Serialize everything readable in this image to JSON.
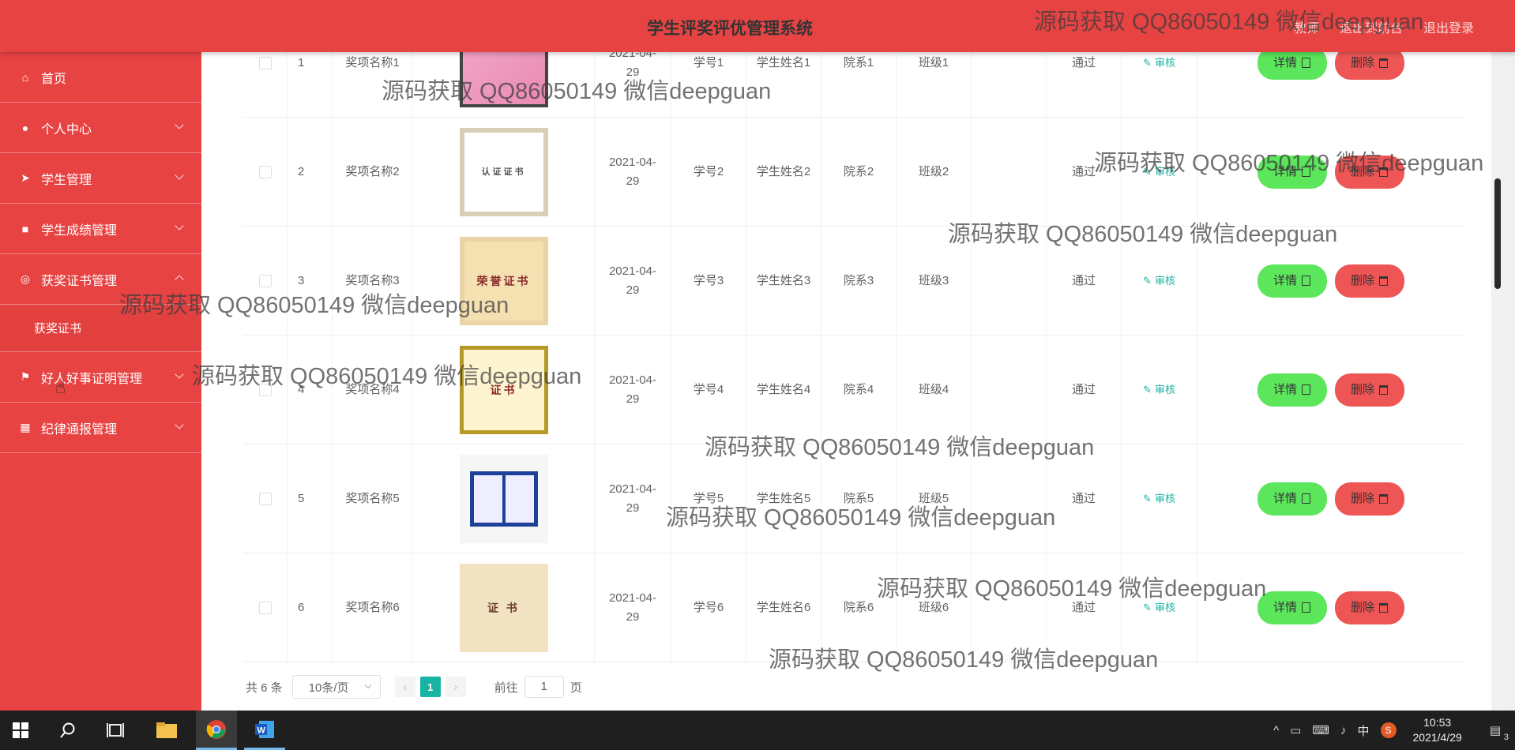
{
  "header": {
    "title": "学生评奖评优管理系统",
    "role_link": "教师",
    "front_link": "退出到前台",
    "logout_link": "退出登录"
  },
  "sidebar": {
    "items": [
      {
        "label": "首页",
        "icon": "home-icon",
        "has_arrow": false
      },
      {
        "label": "个人中心",
        "icon": "user-icon",
        "has_arrow": true
      },
      {
        "label": "学生管理",
        "icon": "send-icon",
        "has_arrow": true
      },
      {
        "label": "学生成绩管理",
        "icon": "video-camera-icon",
        "has_arrow": true
      },
      {
        "label": "获奖证书管理",
        "icon": "globe-icon",
        "has_arrow": true,
        "expanded": true
      },
      {
        "label": "好人好事证明管理",
        "icon": "flag-icon",
        "has_arrow": true
      },
      {
        "label": "纪律通报管理",
        "icon": "grid-icon",
        "has_arrow": true
      }
    ],
    "submenu": {
      "label": "获奖证书"
    }
  },
  "table": {
    "audit_label": "审核",
    "detail_label": "详情",
    "delete_label": "删除",
    "rows": [
      {
        "index": "1",
        "award": "奖项名称1",
        "date": "2021-04-29",
        "student_no": "学号1",
        "student_name": "学生姓名1",
        "faculty": "院系1",
        "class": "班级1",
        "status": "通过"
      },
      {
        "index": "2",
        "award": "奖项名称2",
        "date": "2021-04-29",
        "student_no": "学号2",
        "student_name": "学生姓名2",
        "faculty": "院系2",
        "class": "班级2",
        "status": "通过"
      },
      {
        "index": "3",
        "award": "奖项名称3",
        "date": "2021-04-29",
        "student_no": "学号3",
        "student_name": "学生姓名3",
        "faculty": "院系3",
        "class": "班级3",
        "status": "通过"
      },
      {
        "index": "4",
        "award": "奖项名称4",
        "date": "2021-04-29",
        "student_no": "学号4",
        "student_name": "学生姓名4",
        "faculty": "院系4",
        "class": "班级4",
        "status": "通过"
      },
      {
        "index": "5",
        "award": "奖项名称5",
        "date": "2021-04-29",
        "student_no": "学号5",
        "student_name": "学生姓名5",
        "faculty": "院系5",
        "class": "班级5",
        "status": "通过"
      },
      {
        "index": "6",
        "award": "奖项名称6",
        "date": "2021-04-29",
        "student_no": "学号6",
        "student_name": "学生姓名6",
        "faculty": "院系6",
        "class": "班级6",
        "status": "通过"
      }
    ],
    "cert_captions": [
      "",
      "认证证书",
      "荣誉证书",
      "证书",
      "",
      "证 书"
    ]
  },
  "pagination": {
    "total": "共 6 条",
    "page_size": "10条/页",
    "current_page": "1",
    "goto_label": "前往",
    "goto_value": "1",
    "page_suffix": "页"
  },
  "watermark": "源码获取 QQ86050149 微信deepguan",
  "taskbar": {
    "time": "10:53",
    "date": "2021/4/29",
    "ime": "中",
    "notification_count": "3"
  }
}
